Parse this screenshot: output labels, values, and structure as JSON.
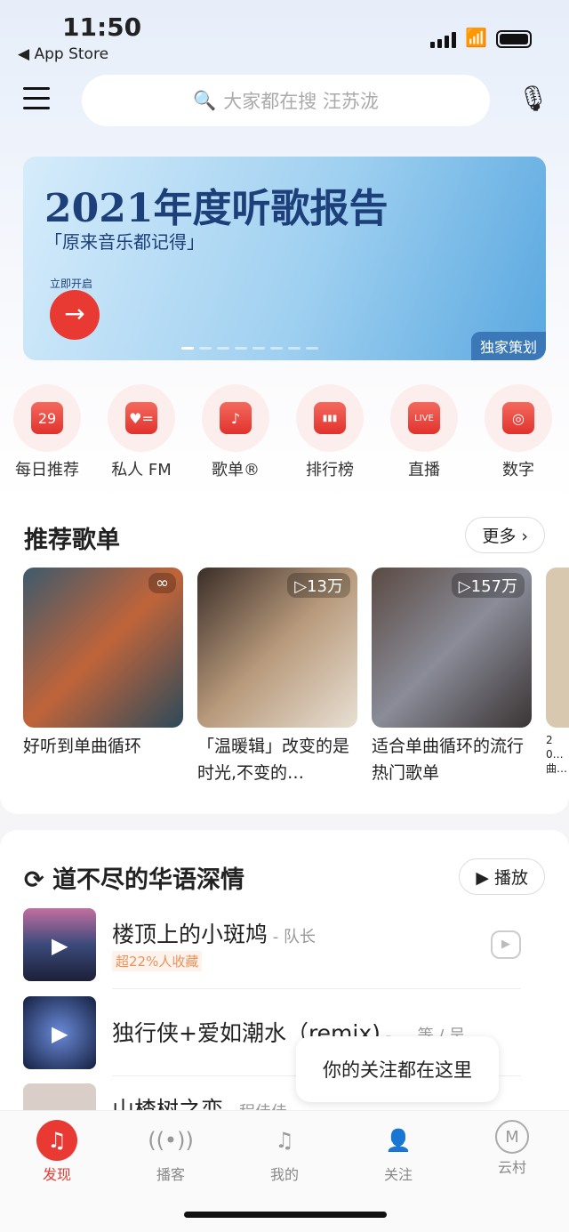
{
  "status": {
    "time": "11:50",
    "back": "◀ App Store"
  },
  "search": {
    "placeholder": "大家都在搜 汪苏泷"
  },
  "banner": {
    "title": "2021年度听歌报告",
    "subtitle": "「原来音乐都记得」",
    "cta": "立即开启",
    "tag": "独家策划"
  },
  "quick": [
    {
      "label": "每日推荐",
      "icon": "calendar-icon",
      "glyph": "29"
    },
    {
      "label": "私人 FM",
      "icon": "radio-icon",
      "glyph": "♥="
    },
    {
      "label": "歌单®",
      "icon": "playlist-icon",
      "glyph": "♪"
    },
    {
      "label": "排行榜",
      "icon": "chart-icon",
      "glyph": "▮▮▮"
    },
    {
      "label": "直播",
      "icon": "live-icon",
      "glyph": "LIVE"
    },
    {
      "label": "数字",
      "icon": "digital-icon",
      "glyph": "◎"
    }
  ],
  "recommend": {
    "title": "推荐歌单",
    "more": "更多 ›",
    "items": [
      {
        "title": "好听到单曲循环",
        "count": "∞"
      },
      {
        "title": "「温暖辑」改变的是时光,不变的…",
        "count": "▷13万"
      },
      {
        "title": "适合单曲循环的流行热门歌单",
        "count": "▷157万"
      },
      {
        "title": "20…曲…",
        "count": ""
      }
    ]
  },
  "songs": {
    "title": "道不尽的华语深情",
    "play": "▶ 播放",
    "items": [
      {
        "title": "楼顶上的小斑鸠",
        "artist": " - 队长",
        "tag": "超22%人收藏"
      },
      {
        "title": "独行侠+爱如潮水（remix)",
        "artist": " - … 等 / 吴…",
        "tag": ""
      },
      {
        "title": "山楂树之恋",
        "artist": " - 程佳佳",
        "tag": ""
      }
    ]
  },
  "tooltip": "你的关注都在这里",
  "tabs": [
    {
      "label": "发现",
      "icon": "netease-logo-icon"
    },
    {
      "label": "播客",
      "icon": "podcast-icon"
    },
    {
      "label": "我的",
      "icon": "music-note-icon"
    },
    {
      "label": "关注",
      "icon": "follow-icon"
    },
    {
      "label": "云村",
      "icon": "cloud-village-icon"
    }
  ]
}
